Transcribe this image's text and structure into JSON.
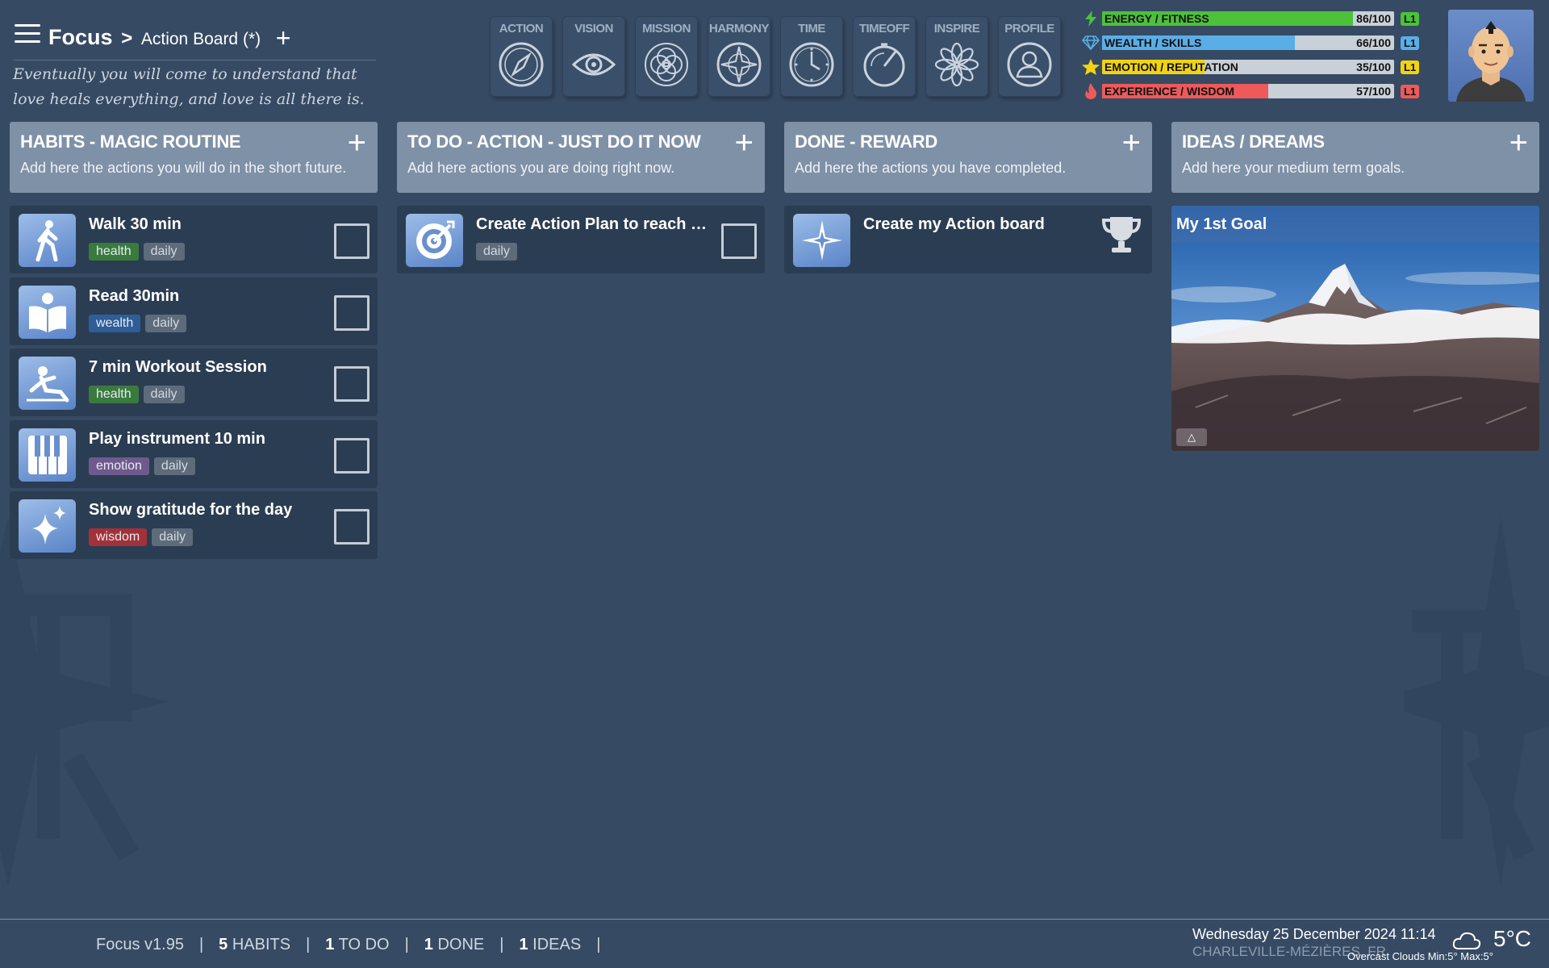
{
  "header": {
    "app_name": "Focus",
    "separator": ">",
    "board_name": "Action Board (*)",
    "add_board_label": "+",
    "quote": "Eventually you will come to understand that love heals everything, and love is all there is."
  },
  "nav": [
    {
      "label": "ACTION",
      "icon": "compass-icon"
    },
    {
      "label": "VISION",
      "icon": "eye-icon"
    },
    {
      "label": "MISSION",
      "icon": "flower-of-life-icon"
    },
    {
      "label": "HARMONY",
      "icon": "compass-rose-icon"
    },
    {
      "label": "TIME",
      "icon": "clock-icon"
    },
    {
      "label": "TIMEOFF",
      "icon": "gauge-icon"
    },
    {
      "label": "INSPIRE",
      "icon": "lotus-icon"
    },
    {
      "label": "PROFILE",
      "icon": "user-icon"
    }
  ],
  "stats": [
    {
      "name": "ENERGY / FITNESS",
      "value": "86/100",
      "level": "L1",
      "percent": 86,
      "color": "#4cc13a",
      "icon": "lightning-icon",
      "icon_color": "#4cc13a",
      "level_color": "#4cc13a"
    },
    {
      "name": "WEALTH / SKILLS",
      "value": "66/100",
      "level": "L1",
      "percent": 66,
      "color": "#5aaee8",
      "icon": "diamond-icon",
      "icon_color": "#5aaee8",
      "level_color": "#5aaee8"
    },
    {
      "name": "EMOTION / REPUTATION",
      "value": "35/100",
      "level": "L1",
      "percent": 35,
      "color": "#f2d312",
      "icon": "star-icon",
      "icon_color": "#f2d312",
      "level_color": "#f2d312"
    },
    {
      "name": "EXPERIENCE / WISDOM",
      "value": "57/100",
      "level": "L1",
      "percent": 57,
      "color": "#ee5a5a",
      "icon": "flame-icon",
      "icon_color": "#ee5a5a",
      "level_color": "#ee5a5a"
    }
  ],
  "columns": [
    {
      "title": "HABITS - MAGIC ROUTINE",
      "desc": "Add here the actions you will do in the short future.",
      "add": "+"
    },
    {
      "title": "TO DO - ACTION - JUST DO IT NOW",
      "desc": "Add here actions you are doing right now.",
      "add": "+"
    },
    {
      "title": "DONE - REWARD",
      "desc": "Add here the actions you have completed.",
      "add": "+"
    },
    {
      "title": "IDEAS / DREAMS",
      "desc": "Add here your medium term goals.",
      "add": "+"
    }
  ],
  "habits": [
    {
      "title": "Walk 30 min",
      "tag": "health",
      "freq": "daily",
      "icon": "walking-icon"
    },
    {
      "title": "Read 30min",
      "tag": "wealth",
      "freq": "daily",
      "icon": "reading-icon"
    },
    {
      "title": "7 min Workout Session",
      "tag": "health",
      "freq": "daily",
      "icon": "workout-icon"
    },
    {
      "title": "Play instrument 10 min",
      "tag": "emotion",
      "freq": "daily",
      "icon": "piano-icon"
    },
    {
      "title": "Show gratitude for the day",
      "tag": "wisdom",
      "freq": "daily",
      "icon": "sparkle-icon"
    }
  ],
  "todo": [
    {
      "title": "Create Action Plan to reach m...",
      "freq": "daily",
      "icon": "target-icon"
    }
  ],
  "done": [
    {
      "title": "Create my Action board",
      "icon": "compass-star-icon",
      "reward_icon": "trophy-icon"
    }
  ],
  "ideas": [
    {
      "title": "My 1st Goal",
      "image": "mountain-image",
      "toggle": "△"
    }
  ],
  "footer": {
    "version": "Focus v1.95",
    "habits_count": "5",
    "habits_label": "HABITS",
    "todo_count": "1",
    "todo_label": "TO DO",
    "done_count": "1",
    "done_label": "DONE",
    "ideas_count": "1",
    "ideas_label": "IDEAS",
    "pipe": "|"
  },
  "weather": {
    "datetime": "Wednesday 25 December 2024 11:14",
    "location": "CHARLEVILLE-MÉZIÈRES, FR",
    "condition": "Overcast Clouds  Min:5°  Max:5°",
    "temperature": "5°C",
    "icon": "cloud-icon"
  }
}
